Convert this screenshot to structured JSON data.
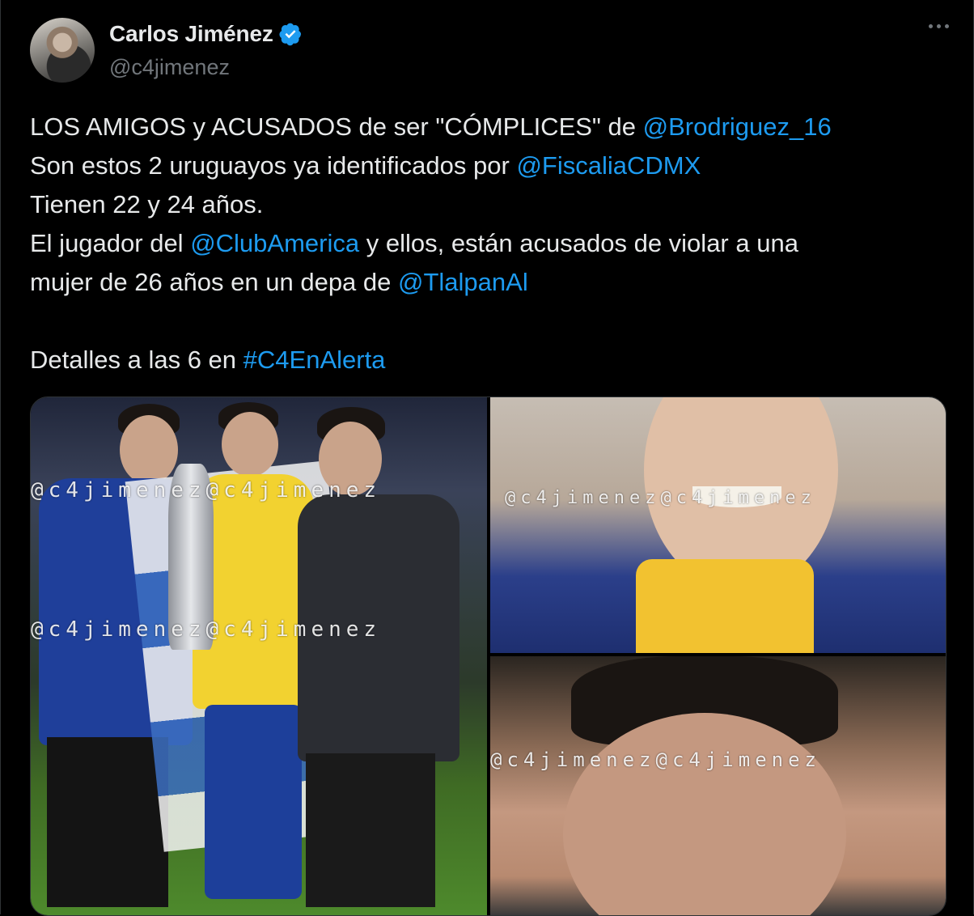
{
  "author": {
    "display_name": "Carlos Jiménez",
    "handle": "@c4jimenez",
    "verified_icon": "verified-badge-icon",
    "more_icon": "more-options-icon"
  },
  "tweet": {
    "l1_a": "LOS AMIGOS y ACUSADOS de ser \"CÓMPLICES\" de ",
    "l1_mention": "@Brodriguez_16",
    "l2_a": "Son estos 2 uruguayos ya identificados por ",
    "l2_mention": "@FiscaliaCDMX",
    "l3": "Tienen 22 y 24 años.",
    "l4_a": "El jugador del ",
    "l4_mention": "@ClubAmerica",
    "l4_b": " y ellos, están acusados de violar a una",
    "l5_a": "mujer de 26 años en un depa de ",
    "l5_mention": "@TlalpanAl",
    "l7_a": "Detalles a las 6 en ",
    "l7_hashtag": "#C4EnAlerta"
  },
  "media": {
    "watermark": "@c4jimenez",
    "watermark_pair": "@c4jimenez@c4jimenez"
  },
  "colors": {
    "background": "#000000",
    "text": "#e7e9ea",
    "muted": "#71767b",
    "link": "#1d9bf0",
    "border": "#2f3336"
  }
}
